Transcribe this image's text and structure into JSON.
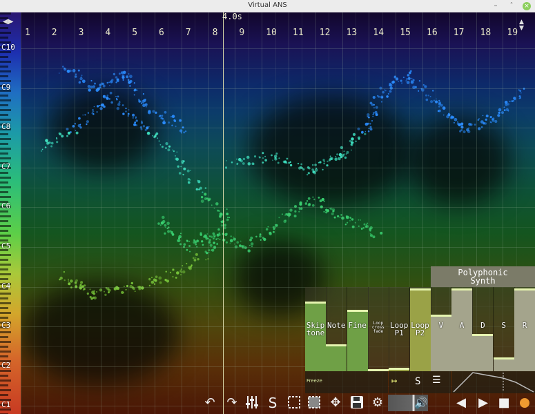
{
  "window": {
    "title": "Virtual ANS"
  },
  "timeline": {
    "current_time": "4.0s",
    "bars": [
      "1",
      "2",
      "3",
      "4",
      "5",
      "6",
      "7",
      "8",
      "9",
      "10",
      "11",
      "12",
      "13",
      "14",
      "15",
      "16",
      "17",
      "18",
      "19"
    ]
  },
  "keyboard": {
    "octaves": [
      "C10",
      "C9",
      "C8",
      "C7",
      "C6",
      "C5",
      "C4",
      "C3",
      "C2",
      "C1"
    ]
  },
  "synth": {
    "title_line1": "Polyphonic",
    "title_line2": "Synth",
    "controls": [
      {
        "id": "skip-tone",
        "label_line1": "Skip",
        "label_line2": "tone",
        "level": 0.82
      },
      {
        "id": "note",
        "label_line1": "Note",
        "label_line2": "",
        "level": 0.3
      },
      {
        "id": "fine",
        "label_line1": "Fine",
        "label_line2": "",
        "level": 0.72
      },
      {
        "id": "loop-cross-fade",
        "label_line1": "Loop",
        "label_line2": "cross fade",
        "level": 0.0
      },
      {
        "id": "loop-p1",
        "label_line1": "Loop",
        "label_line2": "P1",
        "level": 0.02
      },
      {
        "id": "loop-p2",
        "label_line1": "Loop",
        "label_line2": "P2",
        "level": 0.98
      },
      {
        "id": "v",
        "label_line1": "V",
        "label_line2": "",
        "level": 0.66
      },
      {
        "id": "a",
        "label_line1": "A",
        "label_line2": "",
        "level": 0.98
      },
      {
        "id": "d",
        "label_line1": "D",
        "label_line2": "",
        "level": 0.43
      },
      {
        "id": "s",
        "label_line1": "S",
        "label_line2": "",
        "level": 0.14
      },
      {
        "id": "r",
        "label_line1": "R",
        "label_line2": "",
        "level": 0.98
      }
    ],
    "freeze_label": "Freeze",
    "s_label": "S",
    "colors": {
      "yellow": "#e9f07a",
      "green": "#6fa046",
      "olive": "#9aa247",
      "tan": "#a4a48c",
      "cap": "#e6f5b0"
    }
  },
  "toolbar": {
    "tools": [
      "undo-icon",
      "redo-icon",
      "mixer-icon",
      "brush-icon",
      "select-icon",
      "select-filled-icon",
      "move-icon",
      "save-icon",
      "gear-icon",
      "volume-icon",
      "rewind-icon",
      "play-icon",
      "stop-icon",
      "record-icon"
    ],
    "record_color": "#f09a30"
  }
}
